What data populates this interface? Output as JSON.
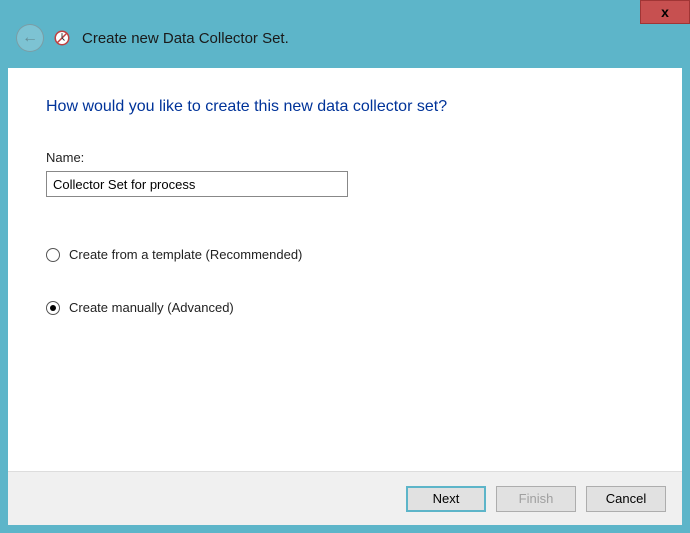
{
  "titlebar": {
    "title": "Create new Data Collector Set.",
    "close": "x"
  },
  "content": {
    "heading": "How would you like to create this new data collector set?",
    "name_label": "Name:",
    "name_value": "Collector Set for process",
    "radios": {
      "template": {
        "label": "Create from a template (Recommended)",
        "selected": false
      },
      "manual": {
        "label": "Create manually (Advanced)",
        "selected": true
      }
    }
  },
  "footer": {
    "next": "Next",
    "finish": "Finish",
    "cancel": "Cancel"
  }
}
